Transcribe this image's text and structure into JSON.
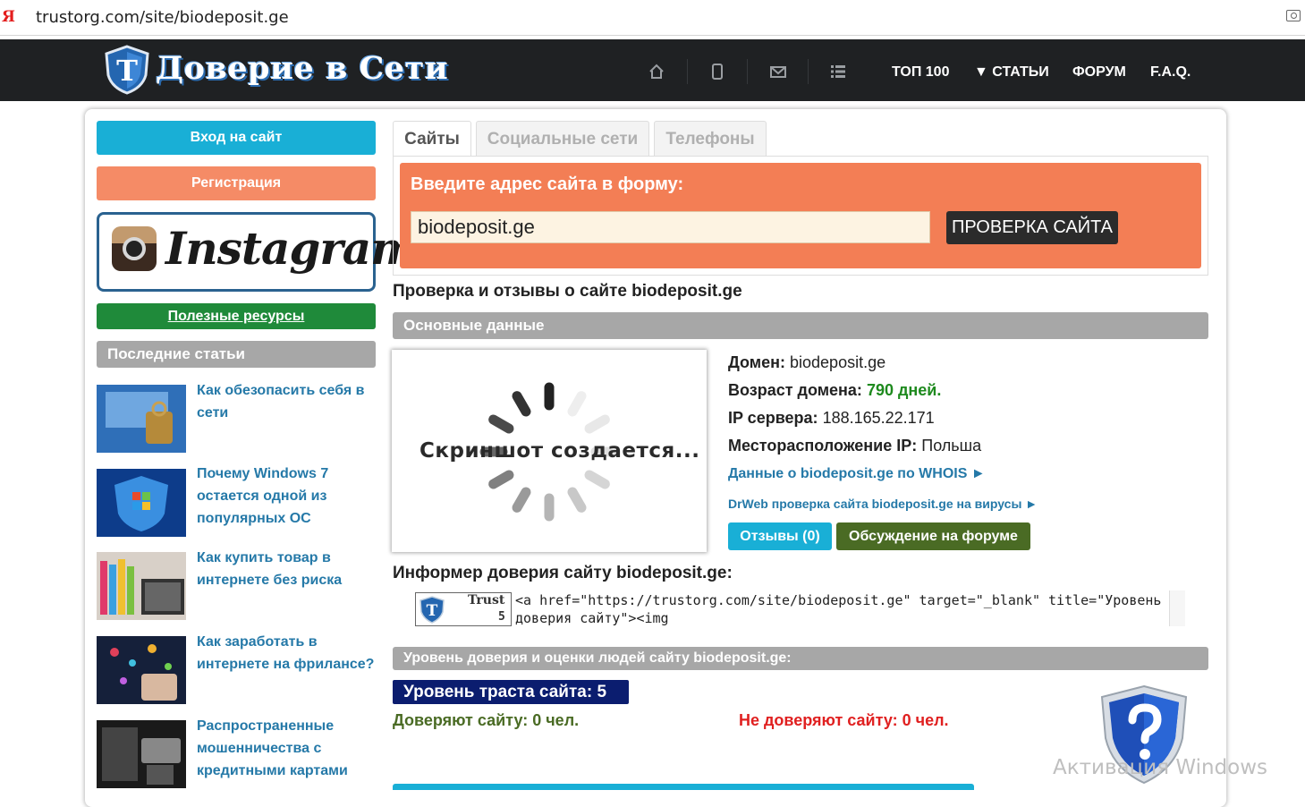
{
  "browser": {
    "brand_glyph": "Я",
    "url": "trustorg.com/site/biodeposit.ge"
  },
  "header": {
    "site_title": "Доверие в Сети",
    "logo_letter": "Т",
    "icons": [
      "home-icon",
      "mobile-icon",
      "mail-icon",
      "list-icon"
    ],
    "nav": {
      "top100": "ТОП 100",
      "articles": "▼ СТАТЬИ",
      "forum": "ФОРУМ",
      "faq": "F.A.Q."
    }
  },
  "sidebar": {
    "login": "Вход на сайт",
    "register": "Регистрация",
    "instagram": "Instagram",
    "resources": "Полезные ресурсы",
    "last_articles": "Последние статьи",
    "articles": [
      {
        "title": "Как обезопасить себя в сети"
      },
      {
        "title": "Почему Windows 7 остается одной из популярных ОС"
      },
      {
        "title": "Как купить товар в интернете без риска"
      },
      {
        "title": "Как заработать в интернете на фрилансе?"
      },
      {
        "title": "Распространенные мошенничества с кредитными картами"
      }
    ]
  },
  "tabs": {
    "sites": "Сайты",
    "social": "Социальные сети",
    "phones": "Телефоны"
  },
  "form": {
    "label": "Введите адрес сайта в форму:",
    "value": "biodeposit.ge",
    "button": "ПРОВЕРКА САЙТА"
  },
  "main": {
    "heading": "Проверка и отзывы о сайте biodeposit.ge",
    "basic_header": "Основные данные",
    "screenshot_text": "Скриншот создается...",
    "domain_label": "Домен:",
    "domain_value": "biodeposit.ge",
    "age_label": "Возраст домена:",
    "age_value": "790 дней.",
    "ip_label": "IP сервера:",
    "ip_value": "188.165.22.171",
    "loc_label": "Месторасположение IP:",
    "loc_value": "Польша",
    "whois_link": "Данные о biodeposit.ge по WHOIS ►",
    "drweb_link": "DrWeb проверка сайта biodeposit.ge на вирусы ►",
    "reviews_btn": "Отзывы (0)",
    "forum_btn": "Обсуждение на форуме",
    "informer_heading": "Информер доверия сайту biodeposit.ge:",
    "badge_trust": "Trust",
    "badge_num": "5",
    "code": "<a href=\"https://trustorg.com/site/biodeposit.ge\" target=\"_blank\" title=\"Уровень доверия сайту\"><img",
    "trust_header": "Уровень доверия и оценки людей сайту biodeposit.ge:",
    "trust_level": "Уровень траста сайта: 5",
    "trust_yes": "Доверяют сайту: 0 чел.",
    "trust_no": "Не доверяют сайту: 0 чел.",
    "watermark": "Активация Windows"
  },
  "colors": {
    "nav_bg": "#1f2123",
    "cyan": "#19afd6",
    "orange": "#f37e55",
    "green": "#1f8a3a",
    "navy": "#0b1d6f",
    "red": "#e02020"
  }
}
